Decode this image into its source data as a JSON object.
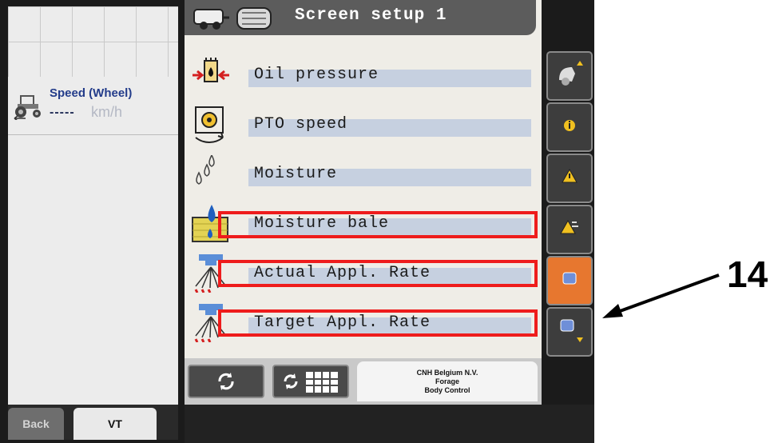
{
  "left_panel": {
    "speed_title": "Speed (Wheel)",
    "speed_value": "-----",
    "speed_unit": "km/h",
    "tractor_icon": "tractor-icon"
  },
  "tabs": {
    "back": "Back",
    "vt": "VT"
  },
  "header": {
    "title": "Screen setup 1",
    "icons": [
      "baler-icon",
      "bale-icon"
    ]
  },
  "rows": [
    {
      "label": "Oil pressure",
      "icon": "oil-pressure-icon",
      "highlighted": false
    },
    {
      "label": "PTO speed",
      "icon": "pto-speed-icon",
      "highlighted": false
    },
    {
      "label": "Moisture",
      "icon": "moisture-drops-icon",
      "highlighted": false
    },
    {
      "label": "Moisture bale",
      "icon": "moisture-bale-icon",
      "highlighted": true
    },
    {
      "label": "Actual Appl. Rate",
      "icon": "actual-application-rate-icon",
      "highlighted": true
    },
    {
      "label": "Target Appl. Rate",
      "icon": "target-application-rate-icon",
      "highlighted": true
    }
  ],
  "bottom_bar": {
    "refresh_icon": "refresh-icon",
    "refresh_grid_icon": "refresh-grid-icon",
    "company_line1": "CNH Belgium N.V.",
    "company_line2": "Forage",
    "company_line3": "Body Control"
  },
  "softkeys": [
    "baler-up-icon",
    "info-icon",
    "warning-icon",
    "warning-list-icon",
    "page-l1-icon",
    "page-l2-down-icon"
  ],
  "colors": {
    "highlight": "#ee1c1c",
    "accent_softkey": "#e7772f",
    "label_bar": "#c6d0e0"
  },
  "annotation": {
    "callout": "14"
  }
}
